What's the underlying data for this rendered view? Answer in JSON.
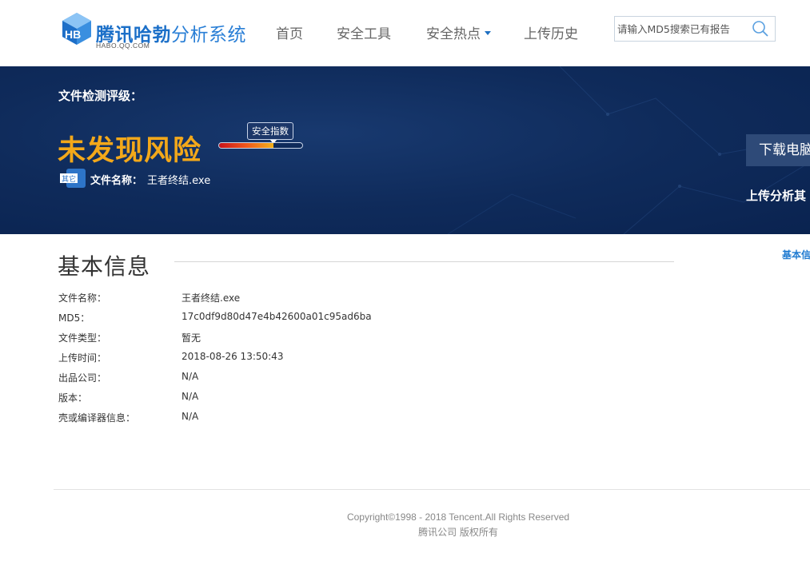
{
  "header": {
    "logo_title_strong": "腾讯哈勃",
    "logo_title_light": "分析系统",
    "logo_subtitle": "HABO.QQ.COM",
    "nav": [
      "首页",
      "安全工具",
      "安全热点",
      "上传历史"
    ],
    "search_placeholder": "请输入MD5搜索已有报告"
  },
  "banner": {
    "eval_label": "文件检测评级：",
    "verdict": "未发现风险",
    "index_label": "安全指数",
    "index_level": 0.65,
    "file_type_badge": "其它",
    "file_name_label": "文件名称：",
    "file_name": "王者终结.exe",
    "download_button": "下载电脑",
    "upload_other_link": "上传分析其"
  },
  "basic_info": {
    "title": "基本信息",
    "side_link": "基本信",
    "rows": [
      {
        "label": "文件名称：",
        "value": "王者终结.exe"
      },
      {
        "label": "MD5：",
        "value": "17c0df9d80d47e4b42600a01c95ad6ba"
      },
      {
        "label": "文件类型：",
        "value": "暂无"
      },
      {
        "label": "上传时间：",
        "value": "2018-08-26 13:50:43"
      },
      {
        "label": "出品公司：",
        "value": "N/A"
      },
      {
        "label": "版本：",
        "value": "N/A"
      },
      {
        "label": "壳或编译器信息：",
        "value": "N/A"
      }
    ]
  },
  "footer": {
    "copyright": "Copyright©1998 - 2018 Tencent.All Rights Reserved",
    "rights": "腾讯公司 版权所有"
  },
  "colors": {
    "brand_blue": "#1b6fc8",
    "banner_navy": "#0f2b5b",
    "verdict_orange": "#f3a81a",
    "link_blue": "#1e7ad0"
  },
  "icons": [
    "habo-logo-icon",
    "search-icon",
    "chevron-down-icon",
    "file-type-icon"
  ]
}
